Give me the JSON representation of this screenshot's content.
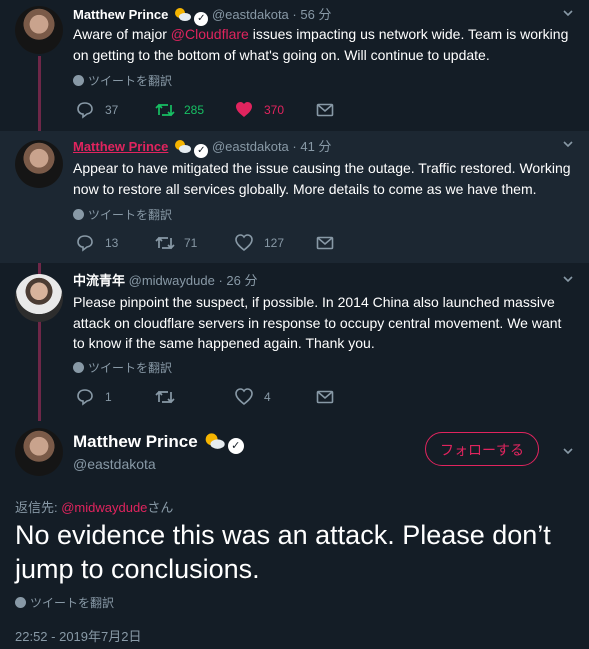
{
  "tweets": [
    {
      "name": "Matthew Prince",
      "handle": "@eastdakota",
      "time": "· 56 分",
      "text_before": "Aware of major ",
      "mention": "@Cloudflare",
      "text_after": " issues impacting us network wide. Team is working on getting to the bottom of what's going on. Will continue to update.",
      "translate": "ツイートを翻訳",
      "replies": "37",
      "retweets": "285",
      "likes": "370"
    },
    {
      "name": "Matthew Prince",
      "handle": "@eastdakota",
      "time": "· 41 分",
      "text": "Appear to have mitigated the issue causing the outage. Traffic restored. Working now to restore all services globally. More details to come as we have them.",
      "translate": "ツイートを翻訳",
      "replies": "13",
      "retweets": "71",
      "likes": "127"
    },
    {
      "name": "中流青年",
      "handle": "@midwaydude",
      "time": "· 26 分",
      "text": "Please pinpoint the suspect, if possible. In 2014 China also launched massive attack on cloudflare servers in response to occupy central movement. We want to know if the same happened again. Thank you.",
      "translate": "ツイートを翻訳",
      "replies": "1",
      "retweets": "",
      "likes": "4"
    }
  ],
  "main": {
    "name": "Matthew Prince",
    "handle": "@eastdakota",
    "follow_label": "フォローする",
    "reply_prefix": "返信先: ",
    "reply_mention": "@midwaydude",
    "reply_suffix": "さん",
    "text": "No evidence this was an attack. Please don’t jump to conclusions.",
    "translate": "ツイートを翻訳",
    "timestamp": "22:52 - 2019年7月2日"
  },
  "colors": {
    "background": "#141d26",
    "highlight": "#1c2732",
    "accent_pink": "#e0245e",
    "retweet_green": "#17bf63",
    "muted": "#8899a6"
  }
}
